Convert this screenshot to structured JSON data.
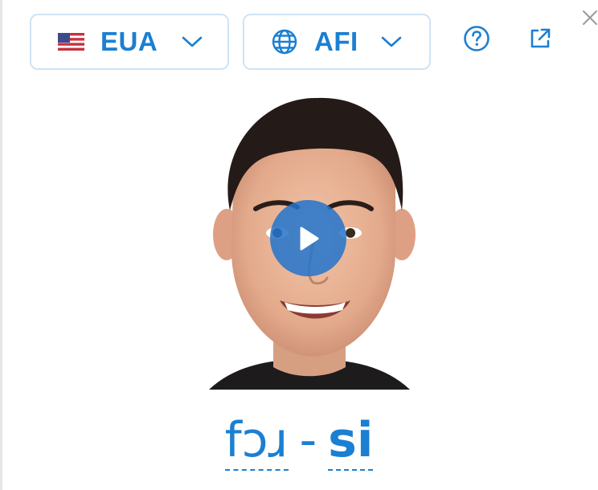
{
  "header": {
    "region_selector": {
      "label": "EUA",
      "icon": "us-flag-icon"
    },
    "notation_selector": {
      "label": "AFI",
      "icon": "globe-icon"
    },
    "help": {
      "icon": "help-circle-icon"
    },
    "open_external": {
      "icon": "external-link-icon"
    },
    "close": {
      "icon": "close-icon"
    }
  },
  "video": {
    "play_icon": "play-icon"
  },
  "pronunciation": {
    "syllables": [
      {
        "text": "fɔɹ",
        "stressed": false
      },
      {
        "text": "si",
        "stressed": true
      }
    ],
    "separator": "-"
  },
  "colors": {
    "accent": "#1b7fd2",
    "pill_border": "#cfe3f5",
    "play_button": "#2474cc",
    "close_icon": "#9a9a9a"
  }
}
